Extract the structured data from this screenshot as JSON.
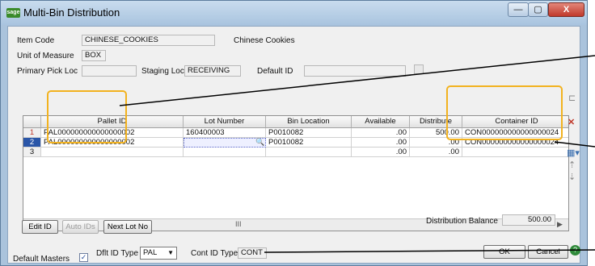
{
  "window": {
    "title": "Multi-Bin Distribution",
    "logo": "sage"
  },
  "titlebar_buttons": {
    "minimize": "—",
    "maximize": "▢",
    "close": "X"
  },
  "header": {
    "item_code_label": "Item Code",
    "item_code_value": "CHINESE_COOKIES",
    "item_description": "Chinese Cookies",
    "uom_label": "Unit of Measure",
    "uom_value": "BOX",
    "primary_pick_label": "Primary Pick Loc",
    "primary_pick_value": "",
    "staging_label": "Staging Loc",
    "staging_value": "RECEIVING",
    "default_id_label": "Default ID",
    "default_id_value": ""
  },
  "grid": {
    "columns": [
      "Pallet ID",
      "Lot Number",
      "Bin Location",
      "Available",
      "Distribute",
      "Container ID"
    ],
    "rows": [
      {
        "num": "1",
        "pallet": "PAL000000000000000002",
        "lot": "160400003",
        "bin": "P0010082",
        "available": ".00",
        "distribute": "500.00",
        "container": "CON000000000000000024"
      },
      {
        "num": "2",
        "pallet": "PAL000000000000000002",
        "lot": "",
        "bin": "P0010082",
        "available": ".00",
        "distribute": ".00",
        "container": "CON000000000000000024"
      },
      {
        "num": "3",
        "pallet": "",
        "lot": "",
        "bin": "",
        "available": ".00",
        "distribute": ".00",
        "container": ""
      }
    ],
    "scroll_grip": "III"
  },
  "buttons": {
    "edit_id": "Edit ID",
    "auto_ids": "Auto IDs",
    "next_lot": "Next Lot No",
    "ok": "OK",
    "cancel": "Cancel"
  },
  "footer": {
    "distribution_balance_label": "Distribution Balance",
    "distribution_balance_value": "500.00",
    "default_masters_label": "Default Masters",
    "default_masters_checked": "✓",
    "dflt_id_type_label": "Dflt ID Type",
    "dflt_id_type_value": "PAL",
    "cont_id_type_label": "Cont ID Type",
    "cont_id_type_value": "CONT"
  },
  "colors": {
    "highlight": "#f2b21f",
    "selected_row": "#2a56a8",
    "window_frame": "#aac3dc"
  }
}
